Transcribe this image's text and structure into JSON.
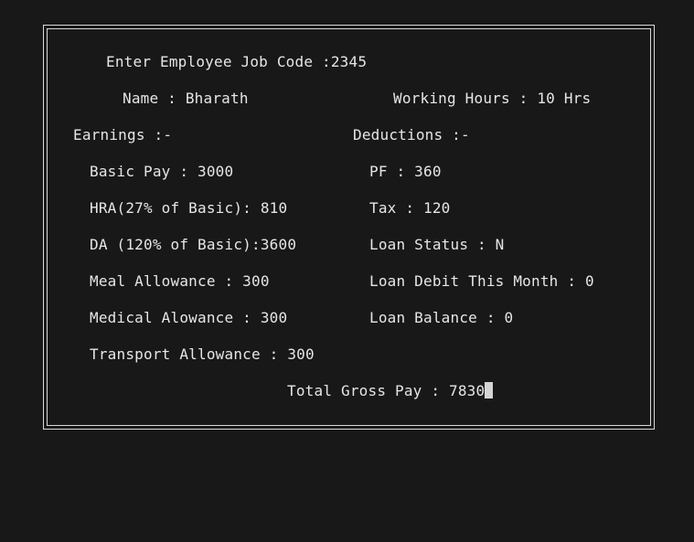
{
  "form": {
    "job_code_label": "Enter Employee Job Code :",
    "job_code_value": "2345",
    "name_line": "Name : Bharath",
    "working_hours_line": "Working Hours : 10 Hrs",
    "earnings_heading": "Earnings :-",
    "deductions_heading": "Deductions :-",
    "earnings": {
      "basic_pay": "Basic Pay : 3000",
      "hra": "HRA(27% of Basic): 810",
      "da": "DA (120% of Basic):3600",
      "meal": "Meal Allowance : 300",
      "medical": "Medical Alowance : 300",
      "transport": "Transport Allowance : 300"
    },
    "deductions": {
      "pf": "PF : 360",
      "tax": "Tax : 120",
      "loan_status": "Loan Status : N",
      "loan_debit": "Loan Debit This Month : 0",
      "loan_balance": "Loan Balance : 0"
    },
    "total_gross_pay": "Total Gross Pay : 7830"
  }
}
